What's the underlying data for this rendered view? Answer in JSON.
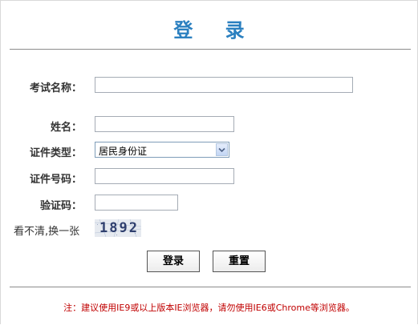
{
  "colors": {
    "title": "#2b80c0",
    "note": "#c00000",
    "captcha_code": "#2f3f6e"
  },
  "page": {
    "title": "登 录"
  },
  "form": {
    "exam_name": {
      "label": "考试名称：",
      "value": ""
    },
    "name": {
      "label": "姓名：",
      "value": ""
    },
    "id_type": {
      "label": "证件类型：",
      "selected": "居民身份证"
    },
    "id_number": {
      "label": "证件号码：",
      "value": ""
    },
    "captcha": {
      "label": "验证码：",
      "value": "",
      "refresh_link": "看不清,换一张",
      "image_text": "1892"
    }
  },
  "buttons": {
    "login": "登录",
    "reset": "重置"
  },
  "footer": {
    "note": "注：建议使用IE9或以上版本IE浏览器，请勿使用IE6或Chrome等浏览器。"
  }
}
